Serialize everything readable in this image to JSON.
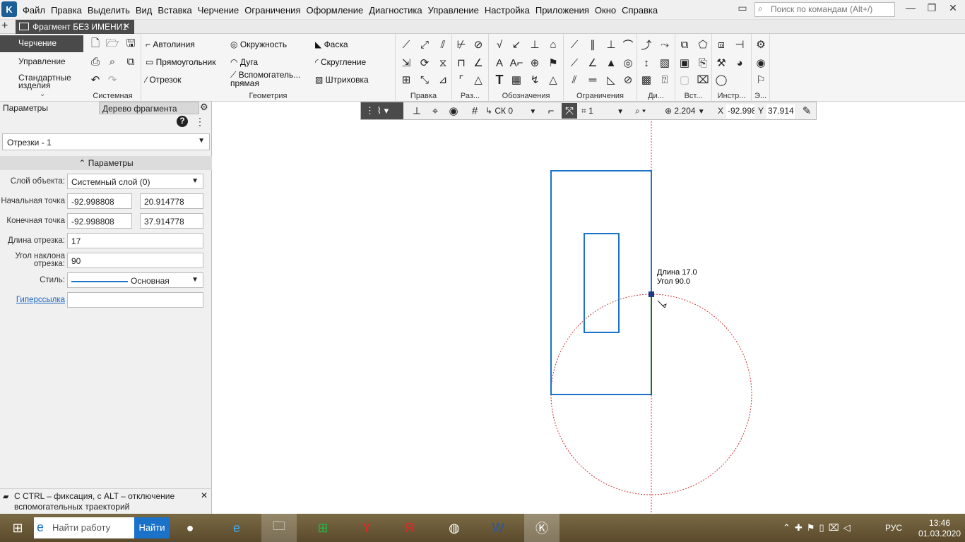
{
  "menu": [
    "Файл",
    "Правка",
    "Выделить",
    "Вид",
    "Вставка",
    "Черчение",
    "Ограничения",
    "Оформление",
    "Диагностика",
    "Управление",
    "Настройка",
    "Приложения",
    "Окно",
    "Справка"
  ],
  "search_placeholder": "Поиск по командам (Alt+/)",
  "doc_tab": "Фрагмент БЕЗ ИМЕНИ1",
  "left_commands": [
    "Черчение",
    "Управление",
    "Стандартные изделия"
  ],
  "geometry": {
    "col1": [
      "Автолиния",
      "Прямоугольник",
      "Отрезок"
    ],
    "col2": [
      "Окружность",
      "Дуга",
      "Вспомогатель... прямая"
    ],
    "col3": [
      "Фаска",
      "Скругление",
      "Штриховка"
    ]
  },
  "group_labels": [
    "Системная",
    "Геометрия",
    "Правка",
    "Раз...",
    "Обозначения",
    "Ограничения",
    "Ди...",
    "Вст...",
    "Инстр...",
    "Э..."
  ],
  "panel": {
    "tab_params": "Параметры",
    "tab_tree": "Дерево фрагмента",
    "object_select": "Отрезки - 1",
    "section": "Параметры",
    "layer_label": "Слой объекта:",
    "layer_value": "Системный слой (0)",
    "start_label": "Начальная точка",
    "start_x": "-92.998808",
    "start_y": "20.914778",
    "end_label": "Конечная точка",
    "end_x": "-92.998808",
    "end_y": "37.914778",
    "length_label": "Длина отрезка:",
    "length_value": "17",
    "angle_label": "Угол наклона отрезка:",
    "angle_value": "90",
    "style_label": "Стиль:",
    "style_value": "Основная",
    "hyperlink_label": "Гиперссылка",
    "hint": "С CTRL – фиксация, с ALT – отключение вспомогательных траекторий"
  },
  "ctoolbar": {
    "cs": "СК 0",
    "layer": "1",
    "zoom": "2.204",
    "x_label": "X",
    "x_value": "-92.998",
    "y_label": "Y",
    "y_value": "37.914"
  },
  "tooltip": {
    "length": "Длина 17.0",
    "angle": "Угол  90.0"
  },
  "taskbar": {
    "search": "Найти работу",
    "search_btn": "Найти",
    "lang": "РУС",
    "time": "13:46",
    "date": "01.03.2020"
  }
}
